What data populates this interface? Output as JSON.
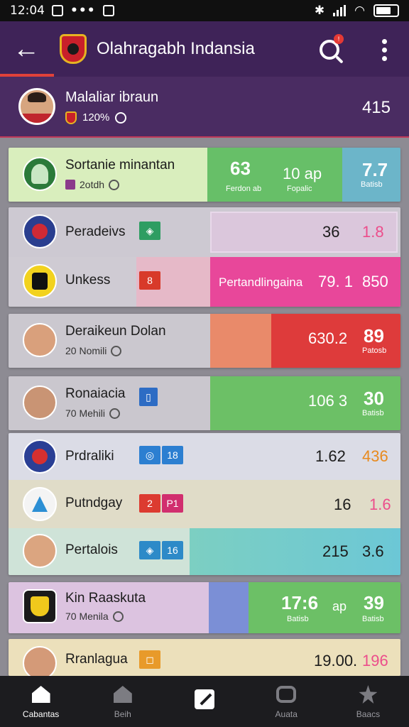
{
  "status_bar": {
    "time": "12:04"
  },
  "header": {
    "title": "Olahragabh Indansia",
    "notification_count": "!"
  },
  "featured": {
    "name": "Malaliar ibraun",
    "sub": "120%",
    "value": "415"
  },
  "rows": [
    {
      "name": "Sortanie minantan",
      "sub": "2otdh",
      "v1": "63",
      "v1_sub": "Ferdon ab",
      "v2": "10 ap",
      "v2_sub": "Fopalic",
      "v3": "7.7",
      "v3_sub": "Batisb"
    },
    {
      "name": "Peradeivs",
      "v1": "36",
      "v2": "1.8"
    },
    {
      "name": "Unkess",
      "tag": "8",
      "caption": "Pertandlingaina",
      "v1": "79. 1",
      "v2": "850"
    },
    {
      "name": "Deraikeun Dolan",
      "sub": "20 Nomili",
      "v1": "630.2",
      "v2": "89",
      "v2_sub": "Patosb"
    },
    {
      "name": "Ronaiacia",
      "sub": "70 Mehili",
      "v1": "106 3",
      "v2": "30",
      "v2_sub": "Batisb"
    },
    {
      "name": "Prdraliki",
      "tag_b": "18",
      "v1": "1.62",
      "v2": "436"
    },
    {
      "name": "Putndgay",
      "tag_a": "2",
      "tag_b": "P1",
      "v1": "16",
      "v2": "1.6"
    },
    {
      "name": "Pertalois",
      "tag_b": "16",
      "v1": "215",
      "v2": "3.6"
    },
    {
      "name": "Kin Raaskuta",
      "sub": "70 Menila",
      "v1": "17:6",
      "v1_sub": "Batisb",
      "mid": "ap",
      "v2": "39",
      "v2_sub": "Batisb"
    },
    {
      "name": "Rranlagua",
      "v1": "19.00.",
      "v2": "196"
    }
  ],
  "nav": [
    "Cabantas",
    "Beih",
    "",
    "Auata",
    "Baacs"
  ],
  "colors": {
    "header": "#3f2358",
    "accent_red": "#e0413a",
    "green": "#6cc066",
    "pink": "#e8489a",
    "red": "#de3b3b"
  }
}
